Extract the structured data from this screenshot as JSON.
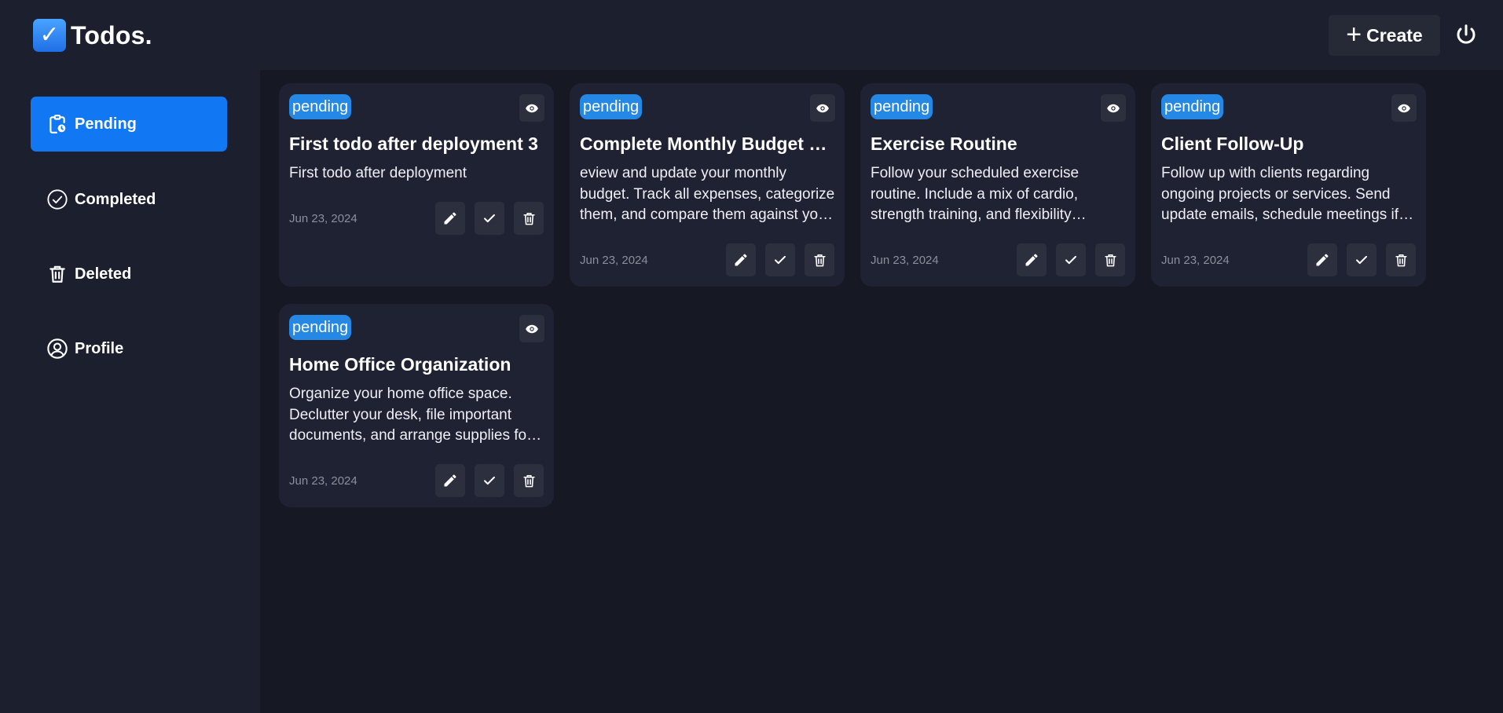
{
  "brand": {
    "name": "Todos.",
    "logo_icon": "check-square-icon",
    "logo_glyph": "✓"
  },
  "header": {
    "create_label": "Create",
    "create_icon": "plus-icon",
    "power_icon": "power-icon"
  },
  "sidebar": {
    "items": [
      {
        "label": "Pending",
        "icon": "clipboard-clock-icon",
        "active": true
      },
      {
        "label": "Completed",
        "icon": "check-circle-icon",
        "active": false
      },
      {
        "label": "Deleted",
        "icon": "trash-icon",
        "active": false
      },
      {
        "label": "Profile",
        "icon": "user-circle-icon",
        "active": false
      }
    ]
  },
  "todos": [
    {
      "status": "pending",
      "title": "First todo after deployment 3",
      "description": "First todo after deployment",
      "date": "Jun 23, 2024"
    },
    {
      "status": "pending",
      "title": "Complete Monthly Budget Review",
      "description": "eview and update your monthly budget. Track all expenses, categorize them, and compare them against your planned budget.",
      "date": "Jun 23, 2024"
    },
    {
      "status": "pending",
      "title": "Exercise Routine",
      "description": "Follow your scheduled exercise routine. Include a mix of cardio, strength training, and flexibility exercises.",
      "date": "Jun 23, 2024"
    },
    {
      "status": "pending",
      "title": "Client Follow-Up",
      "description": "Follow up with clients regarding ongoing projects or services. Send update emails, schedule meetings if needed.",
      "date": "Jun 23, 2024"
    },
    {
      "status": "pending",
      "title": "Home Office Organization",
      "description": "Organize your home office space. Declutter your desk, file important documents, and arrange supplies for efficiency.",
      "date": "Jun 23, 2024"
    }
  ],
  "colors": {
    "accent": "#1277f2",
    "badge": "#2488e4",
    "page_bg": "#161923",
    "panel_bg": "#1c1f2d",
    "card_bg": "#1f2232"
  }
}
